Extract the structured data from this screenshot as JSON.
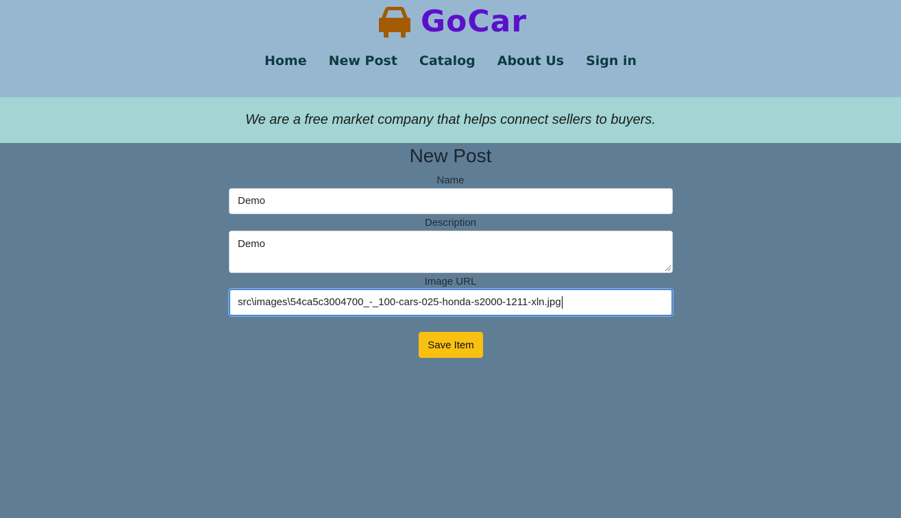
{
  "brand": {
    "name": "GoCar",
    "icon": "car-icon",
    "color": "#5b10c9",
    "icon_color": "#a35a00"
  },
  "nav": {
    "items": [
      {
        "label": "Home"
      },
      {
        "label": "New Post"
      },
      {
        "label": "Catalog"
      },
      {
        "label": "About Us"
      },
      {
        "label": "Sign in"
      }
    ]
  },
  "tagline": "We are a free market company that helps connect sellers to buyers.",
  "form": {
    "title": "New Post",
    "name": {
      "label": "Name",
      "value": "Demo"
    },
    "description": {
      "label": "Description",
      "value": "Demo"
    },
    "image_url": {
      "label": "Image URL",
      "value": "src\\images\\54ca5c3004700_-_100-cars-025-honda-s2000-1211-xln.jpg"
    },
    "save_label": "Save Item"
  },
  "colors": {
    "header_bg": "#97b7d1",
    "tagline_bg": "#a2d5d4",
    "page_bg": "#5f7e96",
    "button_bg": "#f9c012"
  }
}
